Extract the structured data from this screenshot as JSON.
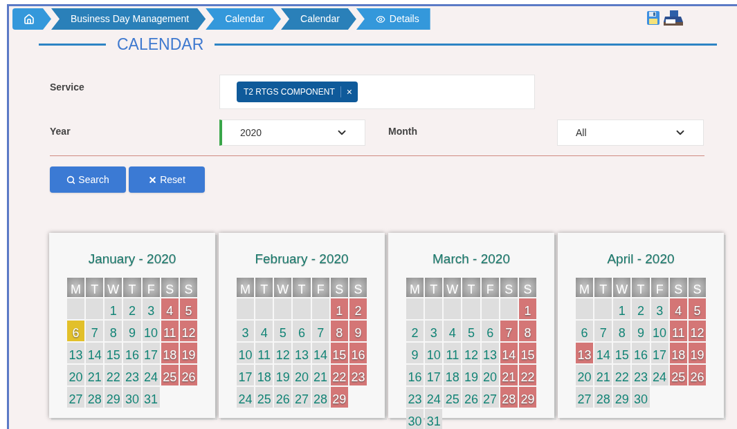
{
  "breadcrumb": [
    {
      "kind": "home"
    },
    {
      "kind": "text",
      "label": "Business Day Management"
    },
    {
      "kind": "text",
      "label": "Calendar"
    },
    {
      "kind": "text",
      "label": "Calendar"
    },
    {
      "kind": "details",
      "label": "Details"
    }
  ],
  "heading": "CALENDAR",
  "form": {
    "service": {
      "label": "Service",
      "tags": [
        {
          "label": "T2 RTGS COMPONENT",
          "remove": "×"
        }
      ]
    },
    "year": {
      "label": "Year",
      "value": "2020"
    },
    "month": {
      "label": "Month",
      "value": "All"
    },
    "buttons": [
      {
        "kind": "search",
        "label": "Search"
      },
      {
        "kind": "reset",
        "label": "Reset"
      }
    ]
  },
  "months": [
    {
      "title": "January - 2020",
      "weekdays": [
        "M",
        "T",
        "W",
        "T",
        "F",
        "S",
        "S"
      ],
      "days": [
        {
          "kind": "blank"
        },
        {
          "kind": "blank"
        },
        {
          "kind": "workday",
          "label": "1"
        },
        {
          "kind": "workday",
          "label": "2"
        },
        {
          "kind": "workday",
          "label": "3"
        },
        {
          "kind": "closed",
          "label": "4"
        },
        {
          "kind": "closed",
          "label": "5"
        },
        {
          "kind": "marked",
          "label": "6"
        },
        {
          "kind": "workday",
          "label": "7"
        },
        {
          "kind": "workday",
          "label": "8"
        },
        {
          "kind": "workday",
          "label": "9"
        },
        {
          "kind": "workday",
          "label": "10"
        },
        {
          "kind": "closed",
          "label": "11"
        },
        {
          "kind": "closed",
          "label": "12"
        },
        {
          "kind": "workday",
          "label": "13"
        },
        {
          "kind": "workday",
          "label": "14"
        },
        {
          "kind": "workday",
          "label": "15"
        },
        {
          "kind": "workday",
          "label": "16"
        },
        {
          "kind": "workday",
          "label": "17"
        },
        {
          "kind": "closed",
          "label": "18"
        },
        {
          "kind": "closed",
          "label": "19"
        },
        {
          "kind": "workday",
          "label": "20"
        },
        {
          "kind": "workday",
          "label": "21"
        },
        {
          "kind": "workday",
          "label": "22"
        },
        {
          "kind": "workday",
          "label": "23"
        },
        {
          "kind": "workday",
          "label": "24"
        },
        {
          "kind": "closed",
          "label": "25"
        },
        {
          "kind": "closed",
          "label": "26"
        },
        {
          "kind": "workday",
          "label": "27"
        },
        {
          "kind": "workday",
          "label": "28"
        },
        {
          "kind": "workday",
          "label": "29"
        },
        {
          "kind": "workday",
          "label": "30"
        },
        {
          "kind": "workday",
          "label": "31"
        }
      ]
    },
    {
      "title": "February - 2020",
      "weekdays": [
        "M",
        "T",
        "W",
        "T",
        "F",
        "S",
        "S"
      ],
      "days": [
        {
          "kind": "blank"
        },
        {
          "kind": "blank"
        },
        {
          "kind": "blank"
        },
        {
          "kind": "blank"
        },
        {
          "kind": "blank"
        },
        {
          "kind": "closed",
          "label": "1"
        },
        {
          "kind": "closed",
          "label": "2"
        },
        {
          "kind": "workday",
          "label": "3"
        },
        {
          "kind": "workday",
          "label": "4"
        },
        {
          "kind": "workday",
          "label": "5"
        },
        {
          "kind": "workday",
          "label": "6"
        },
        {
          "kind": "workday",
          "label": "7"
        },
        {
          "kind": "closed",
          "label": "8"
        },
        {
          "kind": "closed",
          "label": "9"
        },
        {
          "kind": "workday",
          "label": "10"
        },
        {
          "kind": "workday",
          "label": "11"
        },
        {
          "kind": "workday",
          "label": "12"
        },
        {
          "kind": "workday",
          "label": "13"
        },
        {
          "kind": "workday",
          "label": "14"
        },
        {
          "kind": "closed",
          "label": "15"
        },
        {
          "kind": "closed",
          "label": "16"
        },
        {
          "kind": "workday",
          "label": "17"
        },
        {
          "kind": "workday",
          "label": "18"
        },
        {
          "kind": "workday",
          "label": "19"
        },
        {
          "kind": "workday",
          "label": "20"
        },
        {
          "kind": "workday",
          "label": "21"
        },
        {
          "kind": "closed",
          "label": "22"
        },
        {
          "kind": "closed",
          "label": "23"
        },
        {
          "kind": "workday",
          "label": "24"
        },
        {
          "kind": "workday",
          "label": "25"
        },
        {
          "kind": "workday",
          "label": "26"
        },
        {
          "kind": "workday",
          "label": "27"
        },
        {
          "kind": "workday",
          "label": "28"
        },
        {
          "kind": "closed",
          "label": "29"
        }
      ]
    },
    {
      "title": "March - 2020",
      "weekdays": [
        "M",
        "T",
        "W",
        "T",
        "F",
        "S",
        "S"
      ],
      "days": [
        {
          "kind": "blank"
        },
        {
          "kind": "blank"
        },
        {
          "kind": "blank"
        },
        {
          "kind": "blank"
        },
        {
          "kind": "blank"
        },
        {
          "kind": "blank"
        },
        {
          "kind": "closed",
          "label": "1"
        },
        {
          "kind": "workday",
          "label": "2"
        },
        {
          "kind": "workday",
          "label": "3"
        },
        {
          "kind": "workday",
          "label": "4"
        },
        {
          "kind": "workday",
          "label": "5"
        },
        {
          "kind": "workday",
          "label": "6"
        },
        {
          "kind": "closed",
          "label": "7"
        },
        {
          "kind": "closed",
          "label": "8"
        },
        {
          "kind": "workday",
          "label": "9"
        },
        {
          "kind": "workday",
          "label": "10"
        },
        {
          "kind": "workday",
          "label": "11"
        },
        {
          "kind": "workday",
          "label": "12"
        },
        {
          "kind": "workday",
          "label": "13"
        },
        {
          "kind": "closed",
          "label": "14"
        },
        {
          "kind": "closed",
          "label": "15"
        },
        {
          "kind": "workday",
          "label": "16"
        },
        {
          "kind": "workday",
          "label": "17"
        },
        {
          "kind": "workday",
          "label": "18"
        },
        {
          "kind": "workday",
          "label": "19"
        },
        {
          "kind": "workday",
          "label": "20"
        },
        {
          "kind": "closed",
          "label": "21"
        },
        {
          "kind": "closed",
          "label": "22"
        },
        {
          "kind": "workday",
          "label": "23"
        },
        {
          "kind": "workday",
          "label": "24"
        },
        {
          "kind": "workday",
          "label": "25"
        },
        {
          "kind": "workday",
          "label": "26"
        },
        {
          "kind": "workday",
          "label": "27"
        },
        {
          "kind": "closed",
          "label": "28"
        },
        {
          "kind": "closed",
          "label": "29"
        },
        {
          "kind": "workday",
          "label": "30"
        },
        {
          "kind": "workday",
          "label": "31"
        }
      ]
    },
    {
      "title": "April - 2020",
      "weekdays": [
        "M",
        "T",
        "W",
        "T",
        "F",
        "S",
        "S"
      ],
      "days": [
        {
          "kind": "blank"
        },
        {
          "kind": "blank"
        },
        {
          "kind": "workday",
          "label": "1"
        },
        {
          "kind": "workday",
          "label": "2"
        },
        {
          "kind": "workday",
          "label": "3"
        },
        {
          "kind": "closed",
          "label": "4"
        },
        {
          "kind": "closed",
          "label": "5"
        },
        {
          "kind": "workday",
          "label": "6"
        },
        {
          "kind": "workday",
          "label": "7"
        },
        {
          "kind": "workday",
          "label": "8"
        },
        {
          "kind": "workday",
          "label": "9"
        },
        {
          "kind": "workday",
          "label": "10"
        },
        {
          "kind": "closed",
          "label": "11"
        },
        {
          "kind": "closed",
          "label": "12"
        },
        {
          "kind": "closed",
          "label": "13"
        },
        {
          "kind": "workday",
          "label": "14"
        },
        {
          "kind": "workday",
          "label": "15"
        },
        {
          "kind": "workday",
          "label": "16"
        },
        {
          "kind": "workday",
          "label": "17"
        },
        {
          "kind": "closed",
          "label": "18"
        },
        {
          "kind": "closed",
          "label": "19"
        },
        {
          "kind": "workday",
          "label": "20"
        },
        {
          "kind": "workday",
          "label": "21"
        },
        {
          "kind": "workday",
          "label": "22"
        },
        {
          "kind": "workday",
          "label": "23"
        },
        {
          "kind": "workday",
          "label": "24"
        },
        {
          "kind": "closed",
          "label": "25"
        },
        {
          "kind": "closed",
          "label": "26"
        },
        {
          "kind": "workday",
          "label": "27"
        },
        {
          "kind": "workday",
          "label": "28"
        },
        {
          "kind": "workday",
          "label": "29"
        },
        {
          "kind": "workday",
          "label": "30"
        }
      ]
    }
  ]
}
